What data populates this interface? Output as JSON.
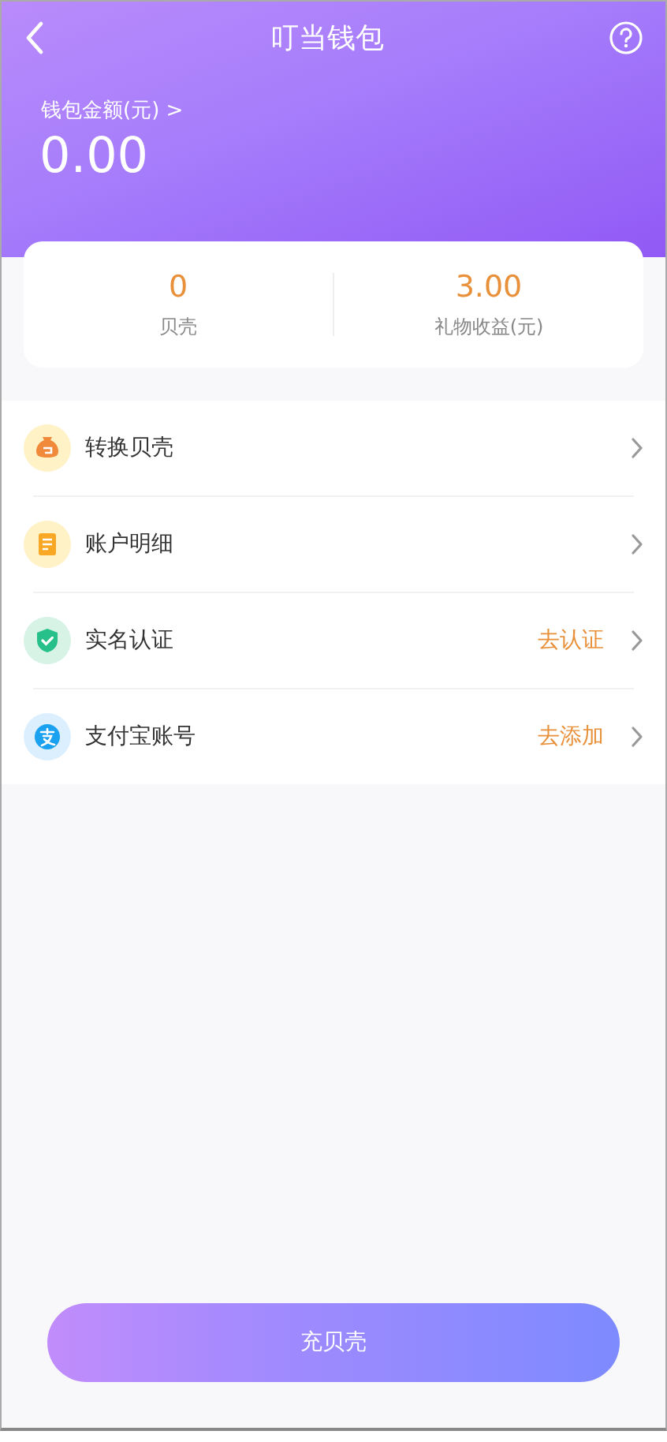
{
  "header": {
    "title": "叮当钱包",
    "balance_label": "钱包金额(元) >",
    "balance": "0.00"
  },
  "stats": [
    {
      "value": "0",
      "label": "贝壳"
    },
    {
      "value": "3.00",
      "label": "礼物收益(元)"
    }
  ],
  "menu": [
    {
      "kind": "bag",
      "label": "转换贝壳"
    },
    {
      "kind": "note",
      "label": "账户明细"
    },
    {
      "kind": "shield",
      "label": "实名认证",
      "action": "去认证"
    },
    {
      "kind": "alipay",
      "label": "支付宝账号",
      "action": "去添加"
    }
  ],
  "primary_button": "充贝壳"
}
